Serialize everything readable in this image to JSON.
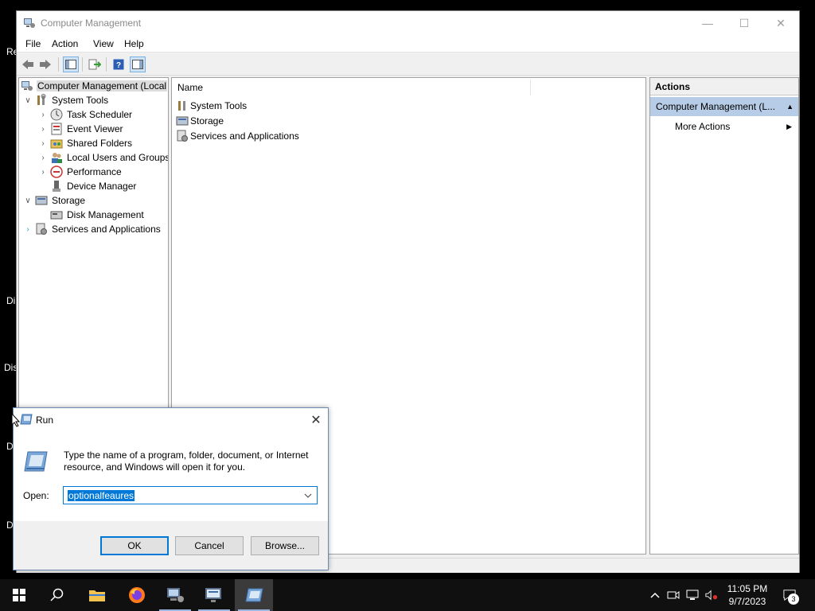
{
  "desktop": {
    "labels": [
      "Re",
      "Di",
      "Dis",
      "D",
      "D"
    ]
  },
  "window": {
    "title": "Computer Management",
    "icon": "computer-management-icon",
    "controls": {
      "minimize": "—",
      "maximize": "☐",
      "close": "✕"
    }
  },
  "menu": {
    "items": [
      "File",
      "Action",
      "View",
      "Help"
    ]
  },
  "toolbar": {
    "buttons": [
      "back-arrow-icon",
      "forward-arrow-icon",
      "show-hide-console-tree-icon",
      "export-list-icon",
      "help-icon",
      "show-hide-action-pane-icon"
    ]
  },
  "tree": {
    "items": [
      {
        "label": "Computer Management (Local",
        "icon": "computer-management-icon",
        "expander": "",
        "selected": true
      },
      {
        "label": "System Tools",
        "icon": "system-tools-icon",
        "expander": "expanded"
      },
      {
        "label": "Task Scheduler",
        "icon": "task-scheduler-icon",
        "expander": "collapsed"
      },
      {
        "label": "Event Viewer",
        "icon": "event-viewer-icon",
        "expander": "collapsed"
      },
      {
        "label": "Shared Folders",
        "icon": "shared-folders-icon",
        "expander": "collapsed"
      },
      {
        "label": "Local Users and Groups",
        "icon": "local-users-icon",
        "expander": "collapsed"
      },
      {
        "label": "Performance",
        "icon": "performance-icon",
        "expander": "collapsed"
      },
      {
        "label": "Device Manager",
        "icon": "device-manager-icon",
        "expander": ""
      },
      {
        "label": "Storage",
        "icon": "storage-icon",
        "expander": "expanded"
      },
      {
        "label": "Disk Management",
        "icon": "disk-management-icon",
        "expander": ""
      },
      {
        "label": "Services and Applications",
        "icon": "services-applications-icon",
        "expander": "collapsed-teal"
      }
    ]
  },
  "list": {
    "columns": [
      "Name",
      ""
    ],
    "rows": [
      {
        "label": "System Tools",
        "icon": "system-tools-icon"
      },
      {
        "label": "Storage",
        "icon": "storage-icon"
      },
      {
        "label": "Services and Applications",
        "icon": "services-applications-icon"
      }
    ]
  },
  "actions": {
    "title": "Actions",
    "section": "Computer Management (L...",
    "items": [
      "More Actions"
    ]
  },
  "run_dialog": {
    "title": "Run",
    "description": "Type the name of a program, folder, document, or Internet resource, and Windows will open it for you.",
    "open_label": "Open:",
    "open_value": "optionalfeaures",
    "ok_label": "OK",
    "cancel_label": "Cancel",
    "browse_label": "Browse...",
    "close_label": "✕"
  },
  "taskbar": {
    "apps": [
      "start-icon",
      "search-icon",
      "file-explorer-icon",
      "firefox-icon",
      "computer-management-icon",
      "remote-desktop-icon",
      "run-icon"
    ],
    "active_app": "run-icon",
    "tray": [
      "chevron-up-icon",
      "meet-now-icon",
      "network-icon",
      "volume-muted-icon"
    ],
    "time": "11:05 PM",
    "date": "9/7/2023",
    "notification_count": "3"
  },
  "colors": {
    "selection": "#0078d7",
    "actions_section_bg": "#b7cce6",
    "taskbar_bg": "#101010"
  }
}
